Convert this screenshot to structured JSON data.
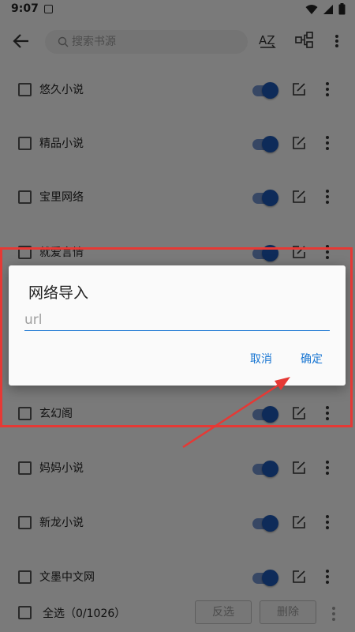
{
  "status_bar": {
    "time": "9:07"
  },
  "toolbar": {
    "search_placeholder": "搜索书源",
    "sort_icon_label": "AZ"
  },
  "sources": [
    {
      "name": "悠久小说",
      "enabled": true
    },
    {
      "name": "精品小说",
      "enabled": true
    },
    {
      "name": "宝里网络",
      "enabled": true
    },
    {
      "name": "就爱言情",
      "enabled": true
    },
    {
      "name": "玄幻阁",
      "enabled": true
    },
    {
      "name": "妈妈小说",
      "enabled": true
    },
    {
      "name": "新龙小说",
      "enabled": true
    },
    {
      "name": "文墨中文网",
      "enabled": true
    }
  ],
  "bottom_bar": {
    "select_all_label": "全选（0/1026）",
    "invert_label": "反选",
    "delete_label": "删除"
  },
  "dialog": {
    "title": "网络导入",
    "input_placeholder": "url",
    "input_value": "",
    "cancel_label": "取消",
    "confirm_label": "确定"
  },
  "colors": {
    "accent": "#1976d2",
    "switch_on": "#1d56b3",
    "annotation": "#e53935"
  }
}
